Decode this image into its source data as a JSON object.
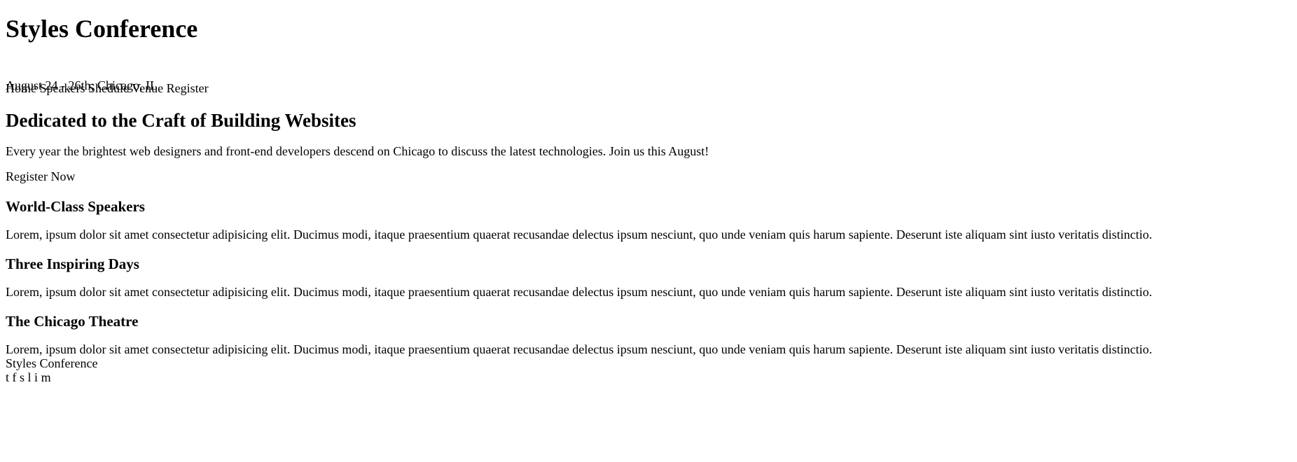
{
  "header": {
    "title": "Styles Conference",
    "tagline": "August 24 - 26th; Chicago, IL"
  },
  "nav": {
    "items": [
      {
        "label": "Home"
      },
      {
        "label": "Speakers"
      },
      {
        "label": "Shedule"
      },
      {
        "label": "Venue"
      },
      {
        "label": "Register"
      }
    ]
  },
  "hero": {
    "title": "Dedicated to the Craft of Building Websites",
    "text": "Every year the brightest web designers and front-end developers descend on Chicago to discuss the latest technologies. Join us this August!",
    "cta": "Register Now"
  },
  "features": [
    {
      "title": "World-Class Speakers",
      "text": "Lorem, ipsum dolor sit amet consectetur adipisicing elit. Ducimus modi, itaque praesentium quaerat recusandae delectus ipsum nesciunt, quo unde veniam quis harum sapiente. Deserunt iste aliquam sint iusto veritatis distinctio."
    },
    {
      "title": "Three Inspiring Days",
      "text": "Lorem, ipsum dolor sit amet consectetur adipisicing elit. Ducimus modi, itaque praesentium quaerat recusandae delectus ipsum nesciunt, quo unde veniam quis harum sapiente. Deserunt iste aliquam sint iusto veritatis distinctio."
    },
    {
      "title": "The Chicago Theatre",
      "text": "Lorem, ipsum dolor sit amet consectetur adipisicing elit. Ducimus modi, itaque praesentium quaerat recusandae delectus ipsum nesciunt, quo unde veniam quis harum sapiente. Deserunt iste aliquam sint iusto veritatis distinctio."
    }
  ],
  "footer": {
    "title": "Styles Conference",
    "social": [
      {
        "label": "t",
        "icon": "twitter-icon"
      },
      {
        "label": "f",
        "icon": "facebook-icon"
      },
      {
        "label": "s",
        "icon": "social-s-icon"
      },
      {
        "label": "l",
        "icon": "linkedin-icon"
      },
      {
        "label": "i",
        "icon": "instagram-icon"
      },
      {
        "label": "m",
        "icon": "mail-icon"
      }
    ]
  }
}
